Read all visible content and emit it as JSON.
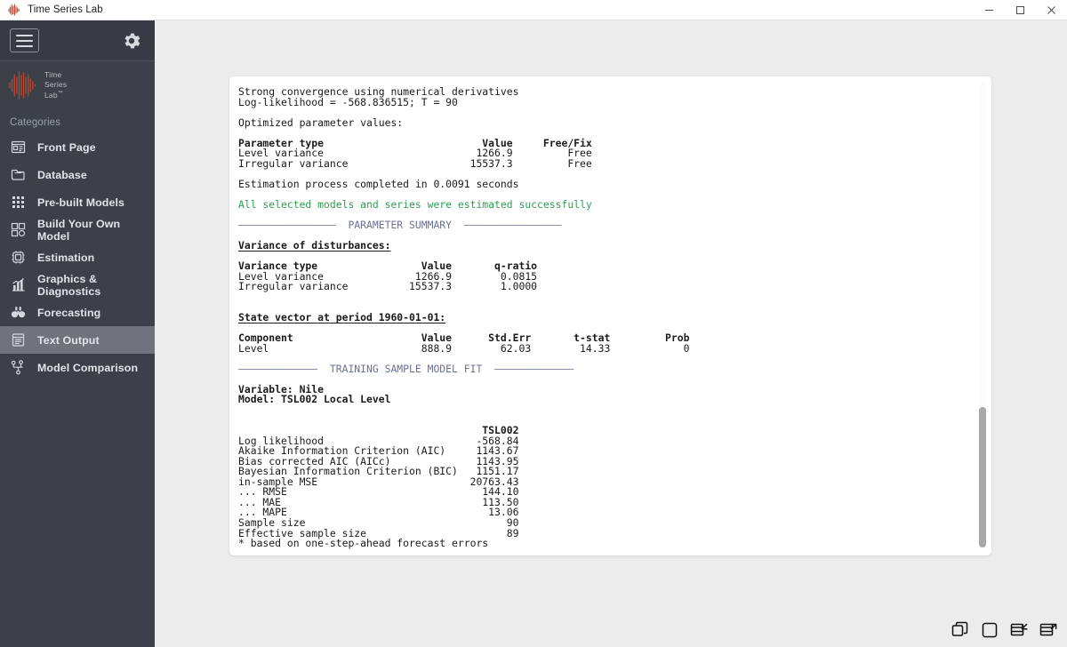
{
  "window": {
    "title": "Time Series Lab",
    "app_icon": "wave-logo-icon",
    "controls": {
      "minimize": "minimize-icon",
      "maximize": "maximize-icon",
      "close": "close-icon"
    }
  },
  "sidebar": {
    "menu_toggle": "hamburger-icon",
    "settings": "gear-icon",
    "logo": {
      "line1": "Time",
      "line2": "Series",
      "line3": "Lab",
      "tm": "™"
    },
    "categories_label": "Categories",
    "items": [
      {
        "label": "Front Page",
        "icon": "front-page-icon",
        "active": false
      },
      {
        "label": "Database",
        "icon": "database-icon",
        "active": false
      },
      {
        "label": "Pre-built Models",
        "icon": "grid-dots-icon",
        "active": false
      },
      {
        "label": "Build Your Own Model",
        "icon": "blocks-icon",
        "active": false
      },
      {
        "label": "Estimation",
        "icon": "chip-icon",
        "active": false
      },
      {
        "label": "Graphics & Diagnostics",
        "icon": "bar-chart-icon",
        "active": false
      },
      {
        "label": "Forecasting",
        "icon": "binoculars-icon",
        "active": false
      },
      {
        "label": "Text Output",
        "icon": "text-document-icon",
        "active": true
      },
      {
        "label": "Model Comparison",
        "icon": "node-tree-icon",
        "active": false
      }
    ]
  },
  "text_output": {
    "lines": [
      {
        "text": "Strong convergence using numerical derivatives",
        "style": "plain"
      },
      {
        "text": "Log-likelihood = -568.836515; T = 90",
        "style": "plain"
      },
      {
        "text": "",
        "style": "plain"
      },
      {
        "text": "Optimized parameter values:",
        "style": "plain"
      },
      {
        "text": "",
        "style": "plain"
      },
      {
        "text": "Parameter type                          Value     Free/Fix",
        "style": "bold"
      },
      {
        "text": "Level variance                         1266.9         Free",
        "style": "plain"
      },
      {
        "text": "Irregular variance                    15537.3         Free",
        "style": "plain"
      },
      {
        "text": "",
        "style": "plain"
      },
      {
        "text": "Estimation process completed in 0.0091 seconds",
        "style": "plain"
      },
      {
        "text": "",
        "style": "plain"
      },
      {
        "text": "All selected models and series were estimated successfully",
        "style": "green"
      },
      {
        "text": "",
        "style": "plain"
      },
      {
        "text": "————————————————  PARAMETER SUMMARY  ————————————————",
        "style": "divider"
      },
      {
        "text": "",
        "style": "plain"
      },
      {
        "text": "Variance of disturbances:",
        "style": "underline"
      },
      {
        "text": "",
        "style": "plain"
      },
      {
        "text": "Variance type                 Value       q-ratio",
        "style": "bold"
      },
      {
        "text": "Level variance               1266.9        0.0815",
        "style": "plain"
      },
      {
        "text": "Irregular variance          15537.3        1.0000",
        "style": "plain"
      },
      {
        "text": "",
        "style": "plain"
      },
      {
        "text": "",
        "style": "plain"
      },
      {
        "text": "State vector at period 1960-01-01:",
        "style": "underline"
      },
      {
        "text": "",
        "style": "plain"
      },
      {
        "text": "Component                     Value      Std.Err       t-stat         Prob",
        "style": "bold"
      },
      {
        "text": "Level                         888.9        62.03        14.33            0",
        "style": "plain"
      },
      {
        "text": "",
        "style": "plain"
      },
      {
        "text": "—————————————  TRAINING SAMPLE MODEL FIT  —————————————",
        "style": "divider"
      },
      {
        "text": "",
        "style": "plain"
      },
      {
        "text": "Variable: Nile",
        "style": "bold"
      },
      {
        "text": "Model: TSL002 Local Level",
        "style": "bold"
      },
      {
        "text": "",
        "style": "plain"
      },
      {
        "text": "",
        "style": "plain"
      },
      {
        "text": "                                        TSL002",
        "style": "bold"
      },
      {
        "text": "Log likelihood                         -568.84",
        "style": "plain"
      },
      {
        "text": "Akaike Information Criterion (AIC)     1143.67",
        "style": "plain"
      },
      {
        "text": "Bias corrected AIC (AICc)              1143.95",
        "style": "plain"
      },
      {
        "text": "Bayesian Information Criterion (BIC)   1151.17",
        "style": "plain"
      },
      {
        "text": "in-sample MSE                         20763.43",
        "style": "plain"
      },
      {
        "text": "... RMSE                                144.10",
        "style": "plain"
      },
      {
        "text": "... MAE                                 113.50",
        "style": "plain"
      },
      {
        "text": "... MAPE                                 13.06",
        "style": "plain"
      },
      {
        "text": "Sample size                                 90",
        "style": "plain"
      },
      {
        "text": "Effective sample size                       89",
        "style": "plain"
      },
      {
        "text": "* based on one-step-ahead forecast errors",
        "style": "plain"
      }
    ]
  },
  "window_layout_buttons": [
    {
      "name": "cascade-windows-icon",
      "label": "Cascade windows"
    },
    {
      "name": "single-window-icon",
      "label": "Single window"
    },
    {
      "name": "restore-down-icon",
      "label": "Restore down"
    },
    {
      "name": "pop-out-window-icon",
      "label": "Pop out window"
    }
  ],
  "colors": {
    "sidebar_bg": "#3b4049",
    "sidebar_active": "#6e737c",
    "main_bg": "#ececec",
    "success_green": "#2e9e4f",
    "divider_blue": "#6a7191",
    "logo_red": "#c0462e"
  }
}
